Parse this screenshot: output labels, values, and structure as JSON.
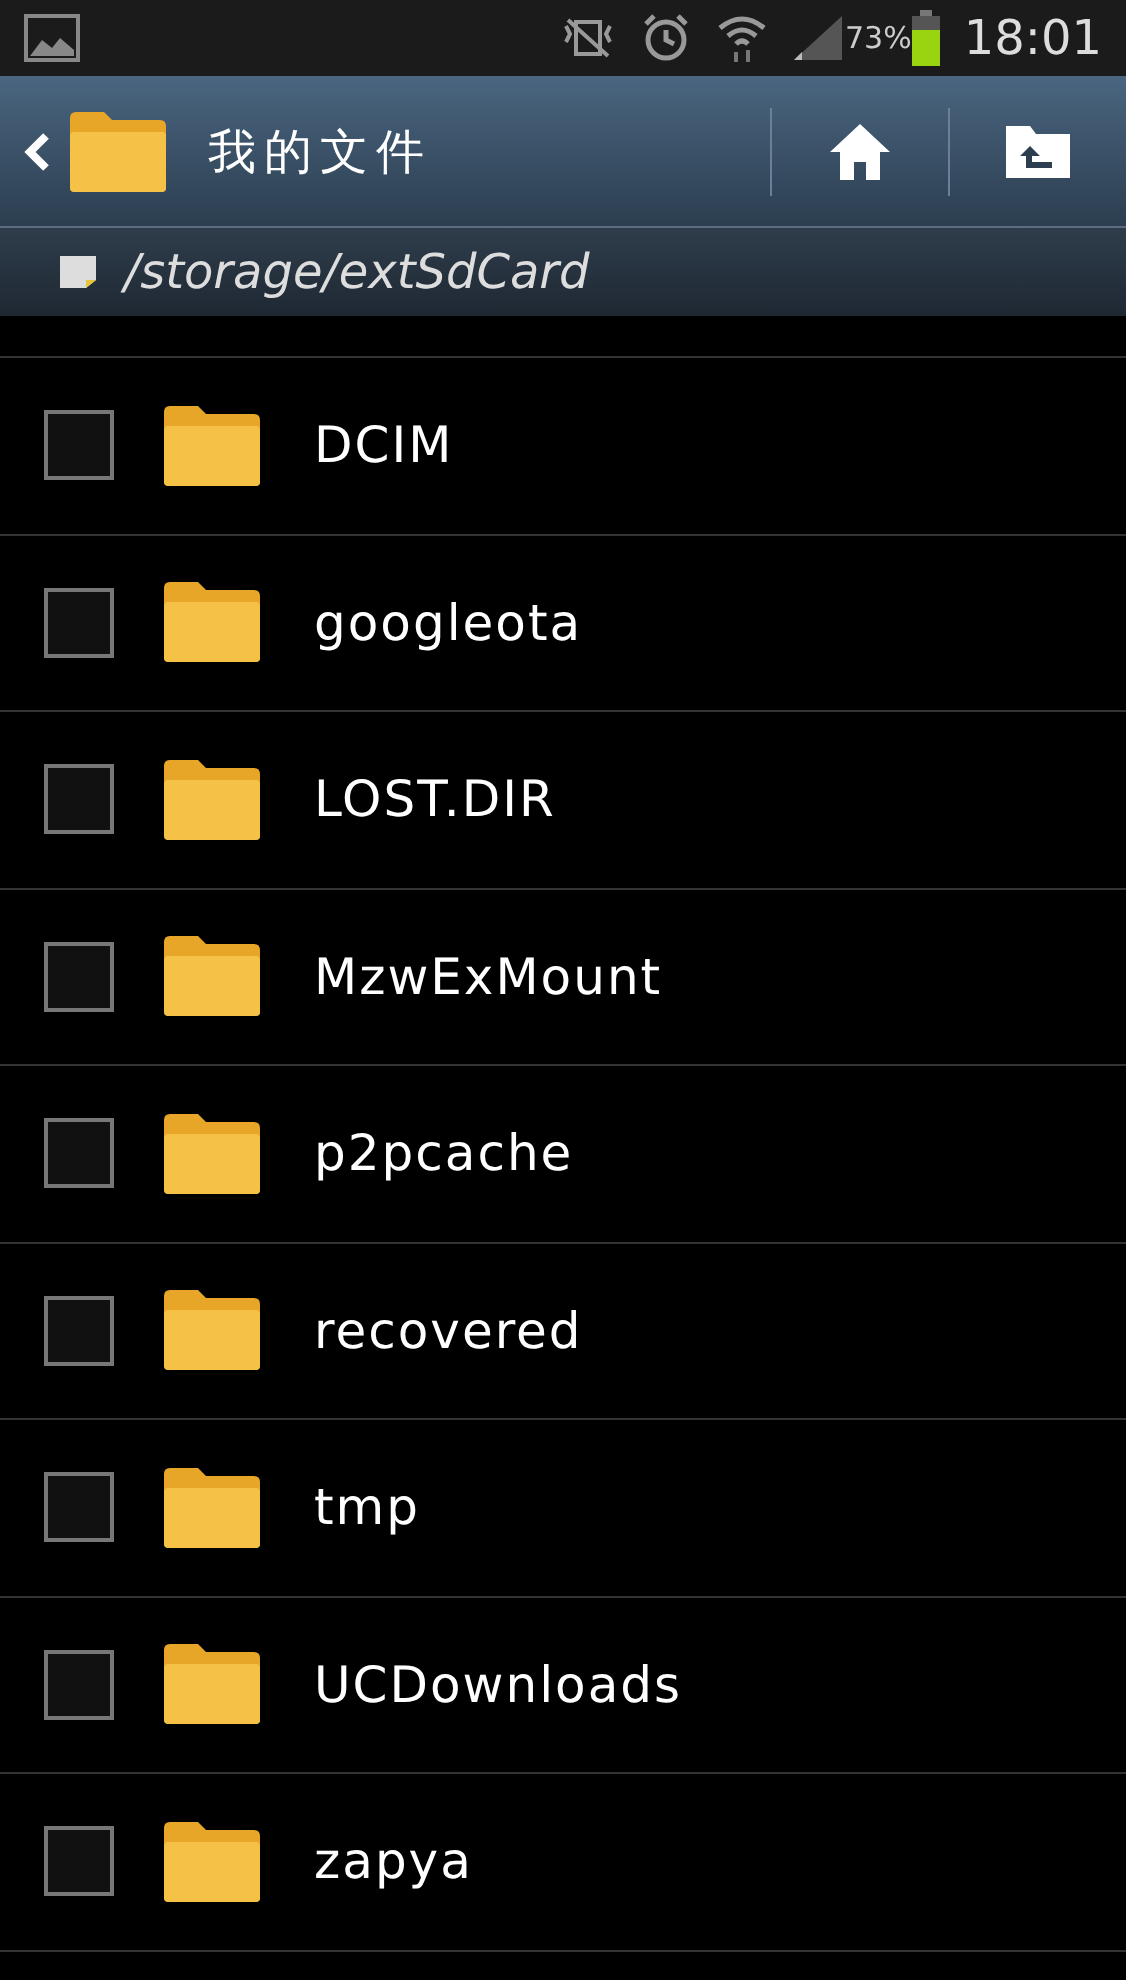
{
  "status_bar": {
    "battery": "73%",
    "time": "18:01"
  },
  "header": {
    "title": "我的文件"
  },
  "path": {
    "text": "/storage/extSdCard"
  },
  "files": [
    {
      "name": "DCIM",
      "checked": false
    },
    {
      "name": "googleota",
      "checked": false
    },
    {
      "name": "LOST.DIR",
      "checked": false
    },
    {
      "name": "MzwExMount",
      "checked": false
    },
    {
      "name": "p2pcache",
      "checked": false
    },
    {
      "name": "recovered",
      "checked": false
    },
    {
      "name": "tmp",
      "checked": false
    },
    {
      "name": "UCDownloads",
      "checked": false
    },
    {
      "name": "zapya",
      "checked": false
    }
  ]
}
